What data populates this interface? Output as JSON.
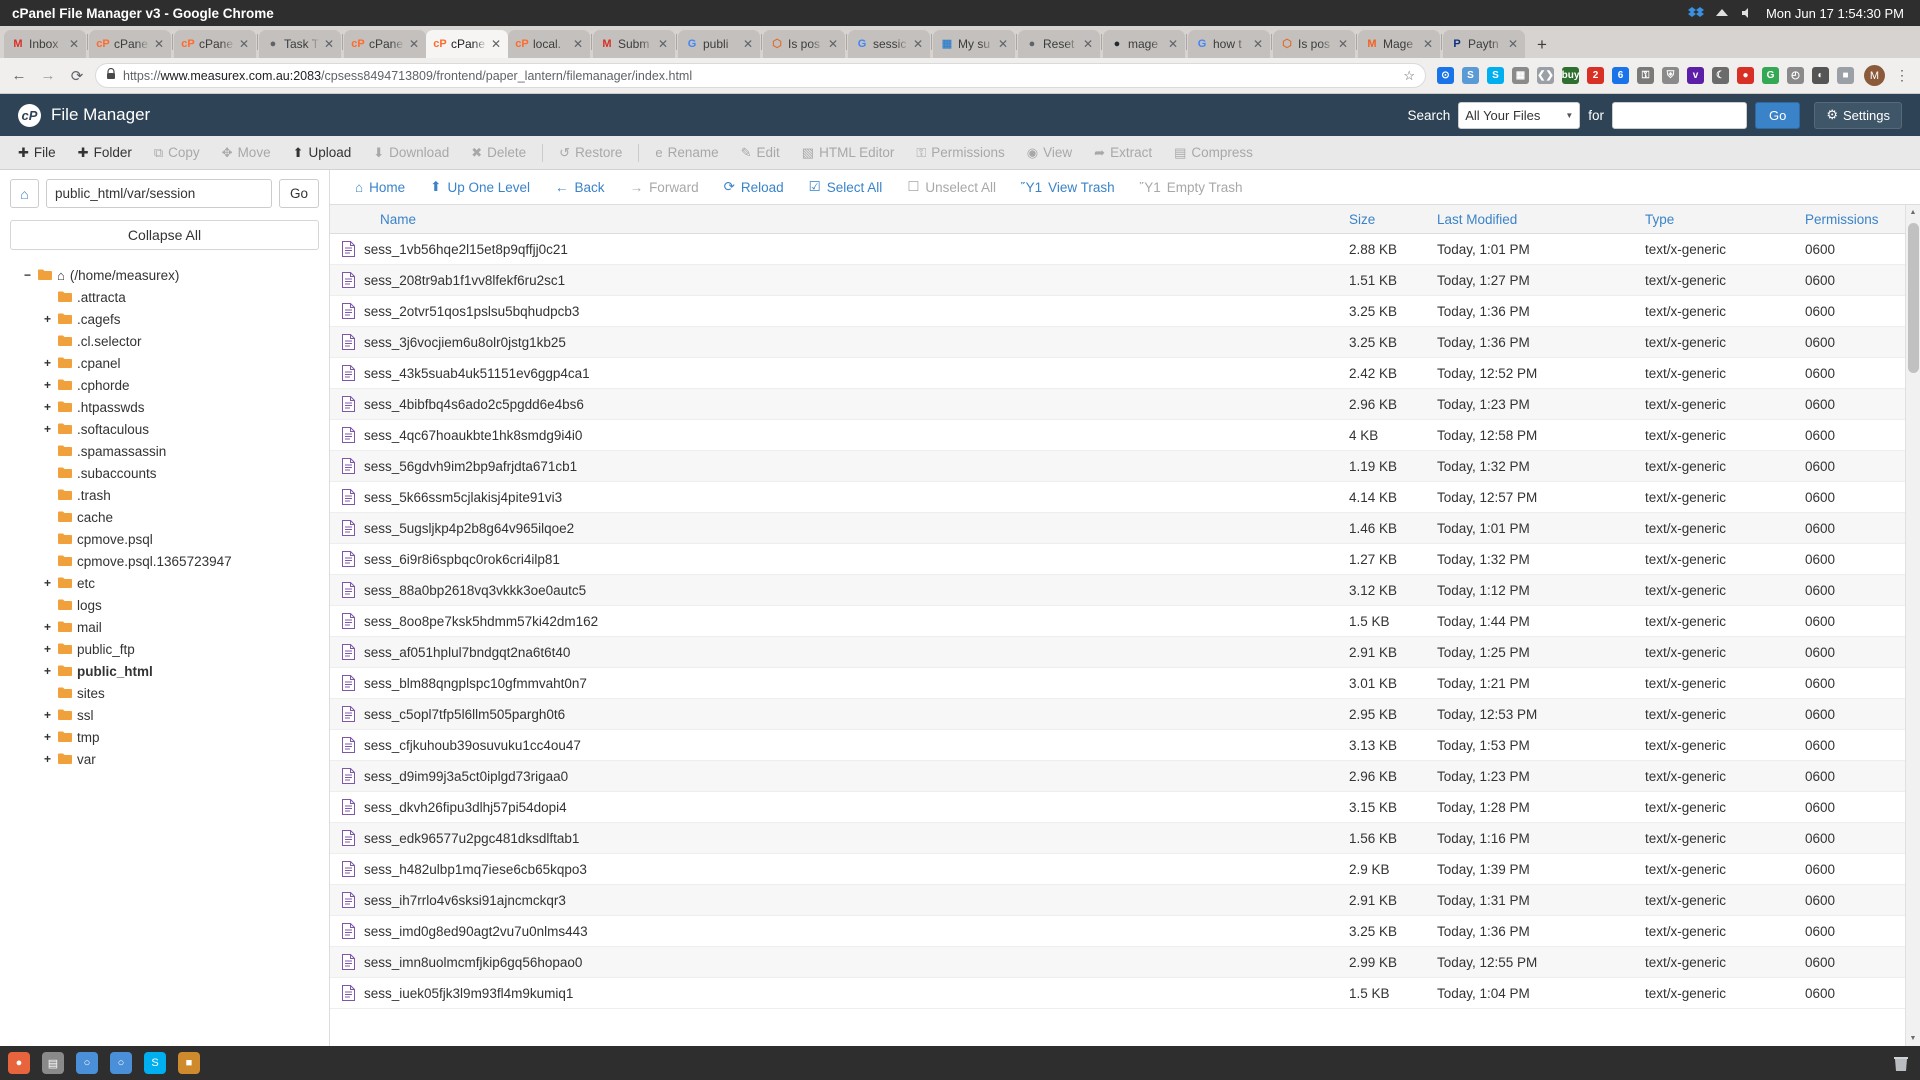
{
  "os": {
    "window_title": "cPanel File Manager v3 - Google Chrome",
    "clock": "Mon Jun 17  1:54:30 PM",
    "taskbar": {
      "apps": [
        {
          "name": "activities-icon",
          "glyph": "●"
        },
        {
          "name": "files-icon",
          "glyph": "▤"
        },
        {
          "name": "chrome-beta-icon",
          "glyph": "○"
        },
        {
          "name": "chrome-icon",
          "glyph": "○"
        },
        {
          "name": "skype-icon",
          "glyph": "S"
        },
        {
          "name": "sublime-icon",
          "glyph": "■"
        }
      ]
    }
  },
  "browser": {
    "tabs": [
      {
        "label": "Inbox",
        "favicon": "M",
        "favicon_color": "#d93025",
        "active": false
      },
      {
        "label": "cPane",
        "favicon": "cP",
        "favicon_color": "#ff6c2c",
        "active": false
      },
      {
        "label": "cPane",
        "favicon": "cP",
        "favicon_color": "#ff6c2c",
        "active": false
      },
      {
        "label": "Task T",
        "favicon": "●",
        "favicon_color": "#5f6368",
        "active": false
      },
      {
        "label": "cPane",
        "favicon": "cP",
        "favicon_color": "#ff6c2c",
        "active": false
      },
      {
        "label": "cPane",
        "favicon": "cP",
        "favicon_color": "#ff6c2c",
        "active": true
      },
      {
        "label": "local.",
        "favicon": "cP",
        "favicon_color": "#ff6c2c",
        "active": false
      },
      {
        "label": "Subm",
        "favicon": "M",
        "favicon_color": "#d93025",
        "active": false
      },
      {
        "label": "publi",
        "favicon": "G",
        "favicon_color": "#4285f4",
        "active": false
      },
      {
        "label": "Is pos",
        "favicon": "⬡",
        "favicon_color": "#e06c2c",
        "active": false
      },
      {
        "label": "sessic",
        "favicon": "G",
        "favicon_color": "#4285f4",
        "active": false
      },
      {
        "label": "My su",
        "favicon": "▦",
        "favicon_color": "#3a83c9",
        "active": false
      },
      {
        "label": "Reset",
        "favicon": "●",
        "favicon_color": "#5f6368",
        "active": false
      },
      {
        "label": "mage",
        "favicon": "●",
        "favicon_color": "#24292e",
        "active": false
      },
      {
        "label": "how t",
        "favicon": "G",
        "favicon_color": "#4285f4",
        "active": false
      },
      {
        "label": "Is pos",
        "favicon": "⬡",
        "favicon_color": "#e06c2c",
        "active": false
      },
      {
        "label": "Mage",
        "favicon": "M",
        "favicon_color": "#f26322",
        "active": false
      },
      {
        "label": "Paytn",
        "favicon": "P",
        "favicon_color": "#0f2f7f",
        "active": false
      }
    ],
    "new_tab_glyph": "+",
    "nav": {
      "back_glyph": "←",
      "forward_glyph": "→",
      "reload_glyph": "⟳"
    },
    "omnibox": {
      "lock_glyph": "🔒",
      "url_prefix": "https://",
      "url_host": "www.measurex.com.au:2083",
      "url_path": "/cpsess8494713809/frontend/paper_lantern/filemanager/index.html",
      "star_glyph": "☆"
    },
    "extensions": [
      {
        "name": "ext-bitwarden",
        "glyph": "⊙",
        "color": "#1a73e8"
      },
      {
        "name": "ext-snip",
        "glyph": "S",
        "color": "#5b9bd5"
      },
      {
        "name": "ext-skype",
        "glyph": "S",
        "color": "#00aff0"
      },
      {
        "name": "ext-grid",
        "glyph": "▦",
        "color": "#8a8a8a"
      },
      {
        "name": "ext-code",
        "glyph": "❮❯",
        "color": "#9aa0a6"
      },
      {
        "name": "ext-buy",
        "glyph": "buy",
        "color": "#2f6f2f"
      },
      {
        "name": "ext-mail-badge",
        "glyph": "2",
        "color": "#d93025"
      },
      {
        "name": "ext-blue-badge",
        "glyph": "6",
        "color": "#1a73e8"
      },
      {
        "name": "ext-lock",
        "glyph": "⚿",
        "color": "#7a7a7a"
      },
      {
        "name": "ext-shield",
        "glyph": "⛨",
        "color": "#8a8a8a"
      },
      {
        "name": "ext-vimeo",
        "glyph": "v",
        "color": "#5b1fa8"
      },
      {
        "name": "ext-moon",
        "glyph": "☾",
        "color": "#6b6b6b"
      },
      {
        "name": "ext-red-dot",
        "glyph": "●",
        "color": "#d93025"
      },
      {
        "name": "ext-green-dot",
        "glyph": "G",
        "color": "#34a853"
      },
      {
        "name": "ext-clock",
        "glyph": "◴",
        "color": "#8a8a8a"
      },
      {
        "name": "ext-dark",
        "glyph": "◐",
        "color": "#555555"
      },
      {
        "name": "ext-grey",
        "glyph": "■",
        "color": "#9aa0a6"
      }
    ],
    "profile_initial": "M",
    "menu_glyph": "⋮"
  },
  "cpanel": {
    "brand": "cP",
    "title": "File Manager",
    "search": {
      "label": "Search",
      "scope_value": "All Your Files",
      "scope_caret": "▼",
      "for_label": "for",
      "query_value": "",
      "query_placeholder": "",
      "go_label": "Go"
    },
    "settings": {
      "icon": "⚙",
      "label": "Settings"
    }
  },
  "toolbar": {
    "items": [
      {
        "label": "File",
        "icon": "✚",
        "disabled": false,
        "name": "file-button"
      },
      {
        "label": "Folder",
        "icon": "✚",
        "disabled": false,
        "name": "folder-button"
      },
      {
        "label": "Copy",
        "icon": "⧉",
        "disabled": true,
        "name": "copy-button"
      },
      {
        "label": "Move",
        "icon": "✥",
        "disabled": true,
        "name": "move-button"
      },
      {
        "label": "Upload",
        "icon": "⬆",
        "disabled": false,
        "name": "upload-button"
      },
      {
        "label": "Download",
        "icon": "⬇",
        "disabled": true,
        "name": "download-button"
      },
      {
        "label": "Delete",
        "icon": "✖",
        "disabled": true,
        "name": "delete-button"
      },
      {
        "label": "Restore",
        "icon": "↺",
        "disabled": true,
        "name": "restore-button"
      },
      {
        "label": "Rename",
        "icon": "὜e",
        "disabled": true,
        "name": "rename-button"
      },
      {
        "label": "Edit",
        "icon": "✎",
        "disabled": true,
        "name": "edit-button"
      },
      {
        "label": "HTML Editor",
        "icon": "▧",
        "disabled": true,
        "name": "html-editor-button"
      },
      {
        "label": "Permissions",
        "icon": "⚿",
        "disabled": true,
        "name": "permissions-button"
      },
      {
        "label": "View",
        "icon": "◉",
        "disabled": true,
        "name": "view-button"
      },
      {
        "label": "Extract",
        "icon": "➦",
        "disabled": true,
        "name": "extract-button"
      },
      {
        "label": "Compress",
        "icon": "▤",
        "disabled": true,
        "name": "compress-button"
      }
    ]
  },
  "sidebar": {
    "home_icon": "⌂",
    "path_value": "public_html/var/session",
    "go_label": "Go",
    "collapse_all_label": "Collapse All",
    "tree": [
      {
        "toggle": "−",
        "indent": 0,
        "label": "(/home/measurex)",
        "home": true,
        "bold": false
      },
      {
        "toggle": "",
        "indent": 1,
        "label": ".attracta",
        "home": false,
        "bold": false
      },
      {
        "toggle": "+",
        "indent": 1,
        "label": ".cagefs",
        "home": false,
        "bold": false
      },
      {
        "toggle": "",
        "indent": 1,
        "label": ".cl.selector",
        "home": false,
        "bold": false
      },
      {
        "toggle": "+",
        "indent": 1,
        "label": ".cpanel",
        "home": false,
        "bold": false
      },
      {
        "toggle": "+",
        "indent": 1,
        "label": ".cphorde",
        "home": false,
        "bold": false
      },
      {
        "toggle": "+",
        "indent": 1,
        "label": ".htpasswds",
        "home": false,
        "bold": false
      },
      {
        "toggle": "+",
        "indent": 1,
        "label": ".softaculous",
        "home": false,
        "bold": false
      },
      {
        "toggle": "",
        "indent": 1,
        "label": ".spamassassin",
        "home": false,
        "bold": false
      },
      {
        "toggle": "",
        "indent": 1,
        "label": ".subaccounts",
        "home": false,
        "bold": false
      },
      {
        "toggle": "",
        "indent": 1,
        "label": ".trash",
        "home": false,
        "bold": false
      },
      {
        "toggle": "",
        "indent": 1,
        "label": "cache",
        "home": false,
        "bold": false
      },
      {
        "toggle": "",
        "indent": 1,
        "label": "cpmove.psql",
        "home": false,
        "bold": false
      },
      {
        "toggle": "",
        "indent": 1,
        "label": "cpmove.psql.1365723947",
        "home": false,
        "bold": false
      },
      {
        "toggle": "+",
        "indent": 1,
        "label": "etc",
        "home": false,
        "bold": false
      },
      {
        "toggle": "",
        "indent": 1,
        "label": "logs",
        "home": false,
        "bold": false
      },
      {
        "toggle": "+",
        "indent": 1,
        "label": "mail",
        "home": false,
        "bold": false
      },
      {
        "toggle": "+",
        "indent": 1,
        "label": "public_ftp",
        "home": false,
        "bold": false
      },
      {
        "toggle": "+",
        "indent": 1,
        "label": "public_html",
        "home": false,
        "bold": true
      },
      {
        "toggle": "",
        "indent": 1,
        "label": "sites",
        "home": false,
        "bold": false
      },
      {
        "toggle": "+",
        "indent": 1,
        "label": "ssl",
        "home": false,
        "bold": false
      },
      {
        "toggle": "+",
        "indent": 1,
        "label": "tmp",
        "home": false,
        "bold": false
      },
      {
        "toggle": "+",
        "indent": 1,
        "label": "var",
        "home": false,
        "bold": false
      }
    ]
  },
  "filenav": {
    "items": [
      {
        "label": "Home",
        "icon": "⌂",
        "disabled": false,
        "name": "nav-home"
      },
      {
        "label": "Up One Level",
        "icon": "⬆",
        "disabled": false,
        "name": "nav-up-one-level"
      },
      {
        "label": "Back",
        "icon": "←",
        "disabled": false,
        "name": "nav-back"
      },
      {
        "label": "Forward",
        "icon": "→",
        "disabled": true,
        "name": "nav-forward"
      },
      {
        "label": "Reload",
        "icon": "⟳",
        "disabled": false,
        "name": "nav-reload"
      },
      {
        "label": "Select All",
        "icon": "☑",
        "disabled": false,
        "name": "nav-select-all"
      },
      {
        "label": "Unselect All",
        "icon": "☐",
        "disabled": true,
        "name": "nav-unselect-all"
      },
      {
        "label": "View Trash",
        "icon": "Ὕ1",
        "disabled": false,
        "name": "nav-view-trash"
      },
      {
        "label": "Empty Trash",
        "icon": "Ὕ1",
        "disabled": true,
        "name": "nav-empty-trash"
      }
    ]
  },
  "table": {
    "columns": [
      "Name",
      "Size",
      "Last Modified",
      "Type",
      "Permissions"
    ],
    "rows": [
      {
        "name": "sess_1vb56hqe2l15et8p9qffjj0c21",
        "size": "2.88 KB",
        "modified": "Today, 1:01 PM",
        "type": "text/x-generic",
        "perm": "0600"
      },
      {
        "name": "sess_208tr9ab1f1vv8lfekf6ru2sc1",
        "size": "1.51 KB",
        "modified": "Today, 1:27 PM",
        "type": "text/x-generic",
        "perm": "0600"
      },
      {
        "name": "sess_2otvr51qos1pslsu5bqhudpcb3",
        "size": "3.25 KB",
        "modified": "Today, 1:36 PM",
        "type": "text/x-generic",
        "perm": "0600"
      },
      {
        "name": "sess_3j6vocjiem6u8olr0jstg1kb25",
        "size": "3.25 KB",
        "modified": "Today, 1:36 PM",
        "type": "text/x-generic",
        "perm": "0600"
      },
      {
        "name": "sess_43k5suab4uk51151ev6ggp4ca1",
        "size": "2.42 KB",
        "modified": "Today, 12:52 PM",
        "type": "text/x-generic",
        "perm": "0600"
      },
      {
        "name": "sess_4bibfbq4s6ado2c5pgdd6e4bs6",
        "size": "2.96 KB",
        "modified": "Today, 1:23 PM",
        "type": "text/x-generic",
        "perm": "0600"
      },
      {
        "name": "sess_4qc67hoaukbte1hk8smdg9i4i0",
        "size": "4 KB",
        "modified": "Today, 12:58 PM",
        "type": "text/x-generic",
        "perm": "0600"
      },
      {
        "name": "sess_56gdvh9im2bp9afrjdta671cb1",
        "size": "1.19 KB",
        "modified": "Today, 1:32 PM",
        "type": "text/x-generic",
        "perm": "0600"
      },
      {
        "name": "sess_5k66ssm5cjlakisj4pite91vi3",
        "size": "4.14 KB",
        "modified": "Today, 12:57 PM",
        "type": "text/x-generic",
        "perm": "0600"
      },
      {
        "name": "sess_5ugsljkp4p2b8g64v965ilqoe2",
        "size": "1.46 KB",
        "modified": "Today, 1:01 PM",
        "type": "text/x-generic",
        "perm": "0600"
      },
      {
        "name": "sess_6i9r8i6spbqc0rok6cri4ilp81",
        "size": "1.27 KB",
        "modified": "Today, 1:32 PM",
        "type": "text/x-generic",
        "perm": "0600"
      },
      {
        "name": "sess_88a0bp2618vq3vkkk3oe0autc5",
        "size": "3.12 KB",
        "modified": "Today, 1:12 PM",
        "type": "text/x-generic",
        "perm": "0600"
      },
      {
        "name": "sess_8oo8pe7ksk5hdmm57ki42dm162",
        "size": "1.5 KB",
        "modified": "Today, 1:44 PM",
        "type": "text/x-generic",
        "perm": "0600"
      },
      {
        "name": "sess_af051hplul7bndgqt2na6t6t40",
        "size": "2.91 KB",
        "modified": "Today, 1:25 PM",
        "type": "text/x-generic",
        "perm": "0600"
      },
      {
        "name": "sess_blm88qngplspc10gfmmvaht0n7",
        "size": "3.01 KB",
        "modified": "Today, 1:21 PM",
        "type": "text/x-generic",
        "perm": "0600"
      },
      {
        "name": "sess_c5opl7tfp5l6llm505pargh0t6",
        "size": "2.95 KB",
        "modified": "Today, 12:53 PM",
        "type": "text/x-generic",
        "perm": "0600"
      },
      {
        "name": "sess_cfjkuhoub39osuvuku1cc4ou47",
        "size": "3.13 KB",
        "modified": "Today, 1:53 PM",
        "type": "text/x-generic",
        "perm": "0600"
      },
      {
        "name": "sess_d9im99j3a5ct0iplgd73rigaa0",
        "size": "2.96 KB",
        "modified": "Today, 1:23 PM",
        "type": "text/x-generic",
        "perm": "0600"
      },
      {
        "name": "sess_dkvh26fipu3dlhj57pi54dopi4",
        "size": "3.15 KB",
        "modified": "Today, 1:28 PM",
        "type": "text/x-generic",
        "perm": "0600"
      },
      {
        "name": "sess_edk96577u2pgc481dksdlftab1",
        "size": "1.56 KB",
        "modified": "Today, 1:16 PM",
        "type": "text/x-generic",
        "perm": "0600"
      },
      {
        "name": "sess_h482ulbp1mq7iese6cb65kqpo3",
        "size": "2.9 KB",
        "modified": "Today, 1:39 PM",
        "type": "text/x-generic",
        "perm": "0600"
      },
      {
        "name": "sess_ih7rrlo4v6sksi91ajncmckqr3",
        "size": "2.91 KB",
        "modified": "Today, 1:31 PM",
        "type": "text/x-generic",
        "perm": "0600"
      },
      {
        "name": "sess_imd0g8ed90agt2vu7u0nlms443",
        "size": "3.25 KB",
        "modified": "Today, 1:36 PM",
        "type": "text/x-generic",
        "perm": "0600"
      },
      {
        "name": "sess_imn8uolmcmfjkip6gq56hopao0",
        "size": "2.99 KB",
        "modified": "Today, 12:55 PM",
        "type": "text/x-generic",
        "perm": "0600"
      },
      {
        "name": "sess_iuek05fjk3l9m93fl4m9kumiq1",
        "size": "1.5 KB",
        "modified": "Today, 1:04 PM",
        "type": "text/x-generic",
        "perm": "0600"
      }
    ]
  },
  "colors": {
    "cpanel_header": "#2e4355",
    "link_blue": "#3a83c9",
    "folder_orange": "#f0a13c",
    "doc_purple": "#7e57a8"
  }
}
